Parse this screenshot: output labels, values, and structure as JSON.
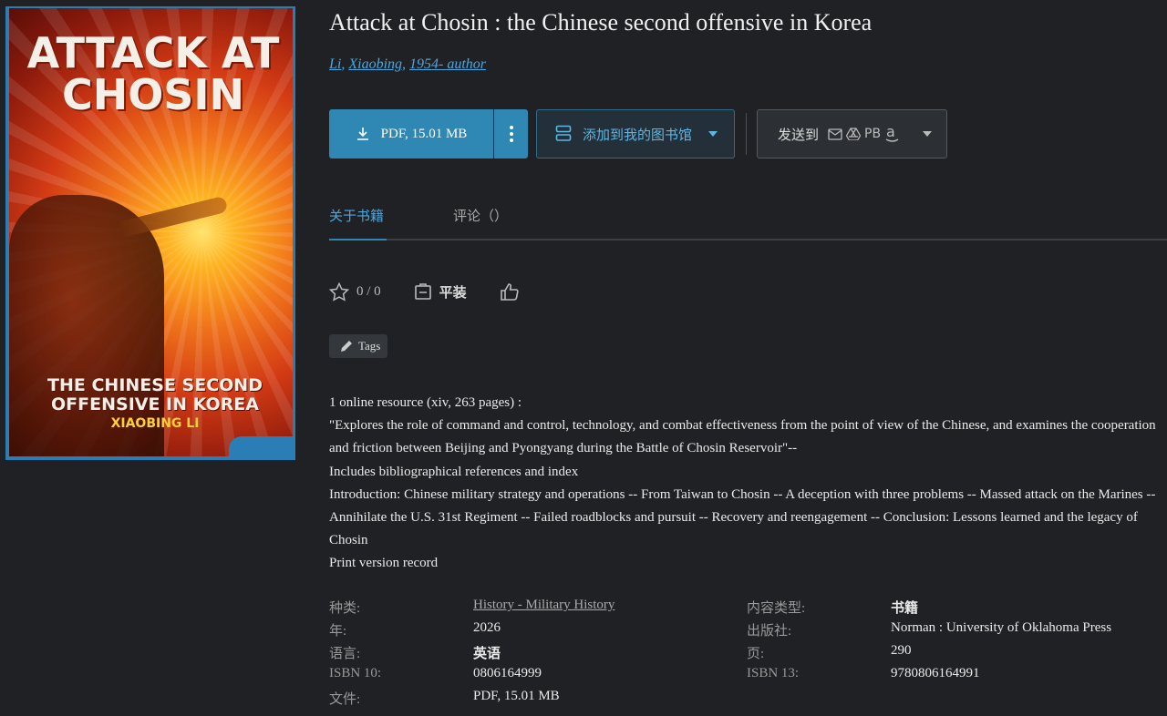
{
  "cover": {
    "title": "ATTACK AT CHOSIN",
    "subtitle": "THE CHINESE SECOND OFFENSIVE IN KOREA",
    "author": "XIAOBING LI"
  },
  "book": {
    "title": "Attack at Chosin : the Chinese second offensive in Korea",
    "authors": [
      "Li",
      "Xiaobing",
      "1954- author"
    ]
  },
  "actions": {
    "download_label": "PDF, 15.01 MB",
    "shelf_label": "添加到我的图书馆",
    "send_label": "发送到",
    "send_pb": "PB"
  },
  "tabs": {
    "about": "关于书籍",
    "reviews": "评论（）"
  },
  "stats": {
    "rating": "0 / 0",
    "status": "平装"
  },
  "tags": {
    "label": "Tags"
  },
  "description": [
    "1 online resource (xiv, 263 pages) :",
    "\"Explores the role of command and control, technology, and combat effectiveness from the point of view of the Chinese, and examines the cooperation and friction between Beijing and Pyongyang during the Battle of Chosin Reservoir\"--",
    "Includes bibliographical references and index",
    "Introduction: Chinese military strategy and operations -- From Taiwan to Chosin -- A deception with three problems -- Massed attack on the Marines -- Annihilate the U.S. 31st Regiment -- Failed roadblocks and pursuit -- Recovery and reengagement -- Conclusion: Lessons learned and the legacy of Chosin",
    "Print version record"
  ],
  "meta": {
    "category_label": "种类:",
    "category_value": "History - Military History",
    "content_type_label": "内容类型:",
    "content_type_value": "书籍",
    "year_label": "年:",
    "year_value": "2026",
    "publisher_label": "出版社:",
    "publisher_value": "Norman : University of Oklahoma Press",
    "language_label": "语言:",
    "language_value": "英语",
    "pages_label": "页:",
    "pages_value": "290",
    "isbn10_label": "ISBN 10:",
    "isbn10_value": "0806164999",
    "isbn13_label": "ISBN 13:",
    "isbn13_value": "9780806164991",
    "file_label": "文件:",
    "file_value": "PDF, 15.01 MB"
  },
  "colors": {
    "background": "#202124",
    "accent": "#2f87b3",
    "link": "#4ea6dc"
  }
}
